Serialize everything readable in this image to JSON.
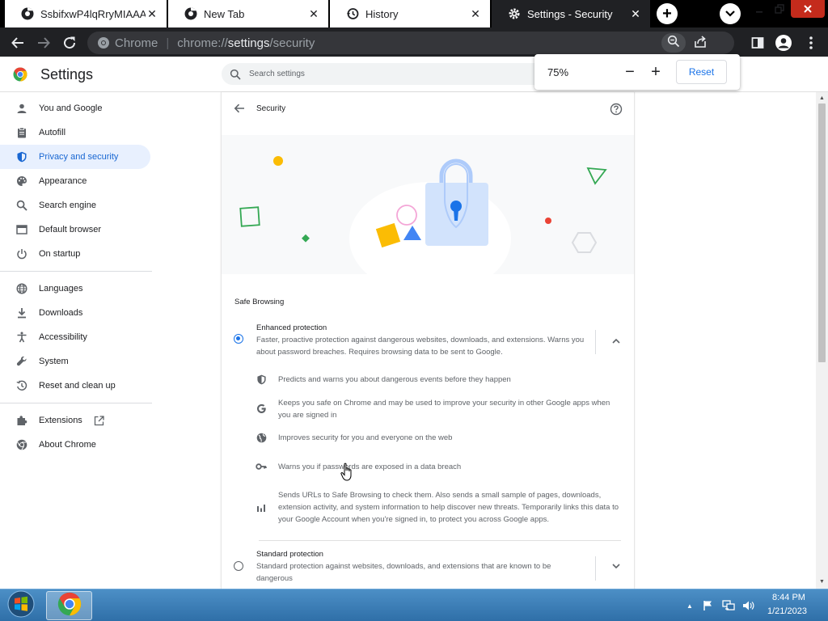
{
  "tabs": [
    {
      "title": "SsbifxwP4lqRryMIAAAA",
      "favicon": "chrome-icon",
      "active": false
    },
    {
      "title": "New Tab",
      "favicon": "chrome-icon",
      "active": false
    },
    {
      "title": "History",
      "favicon": "history-icon",
      "active": false
    },
    {
      "title": "Settings - Security",
      "favicon": "gear-icon",
      "active": true
    }
  ],
  "toolbar": {
    "omnibox_label": "Chrome",
    "url_scheme": "chrome://",
    "url_host": "settings",
    "url_path": "/security"
  },
  "zoom_bubble": {
    "level": "75%",
    "minus_label": "−",
    "plus_label": "+",
    "reset_label": "Reset"
  },
  "header": {
    "title": "Settings",
    "search_placeholder": "Search settings"
  },
  "sidebar": {
    "items": [
      {
        "label": "You and Google",
        "icon": "person-icon",
        "selected": false
      },
      {
        "label": "Autofill",
        "icon": "clipboard-icon",
        "selected": false
      },
      {
        "label": "Privacy and security",
        "icon": "shield-icon",
        "selected": true
      },
      {
        "label": "Appearance",
        "icon": "palette-icon",
        "selected": false
      },
      {
        "label": "Search engine",
        "icon": "search-icon",
        "selected": false
      },
      {
        "label": "Default browser",
        "icon": "browser-icon",
        "selected": false
      },
      {
        "label": "On startup",
        "icon": "power-icon",
        "selected": false
      },
      {
        "label": "Languages",
        "icon": "globe-icon",
        "selected": false
      },
      {
        "label": "Downloads",
        "icon": "download-icon",
        "selected": false
      },
      {
        "label": "Accessibility",
        "icon": "accessibility-icon",
        "selected": false
      },
      {
        "label": "System",
        "icon": "wrench-icon",
        "selected": false
      },
      {
        "label": "Reset and clean up",
        "icon": "history-icon",
        "selected": false
      },
      {
        "label": "Extensions",
        "icon": "puzzle-icon",
        "selected": false
      },
      {
        "label": "About Chrome",
        "icon": "chrome-icon",
        "selected": false
      }
    ]
  },
  "main": {
    "subtitle": "Security",
    "section_title": "Safe Browsing",
    "enhanced": {
      "title": "Enhanced protection",
      "description": "Faster, proactive protection against dangerous websites, downloads, and extensions. Warns you about password breaches. Requires browsing data to be sent to Google.",
      "checked": true
    },
    "features": [
      {
        "icon": "shield-icon",
        "text": "Predicts and warns you about dangerous events before they happen"
      },
      {
        "icon": "google-g-icon",
        "text": "Keeps you safe on Chrome and may be used to improve your security in other Google apps when you are signed in"
      },
      {
        "icon": "globe-icon",
        "text": "Improves security for you and everyone on the web"
      },
      {
        "icon": "key-icon",
        "text": "Warns you if passwords are exposed in a data breach"
      },
      {
        "icon": "bar-chart-icon",
        "text": "Sends URLs to Safe Browsing to check them. Also sends a small sample of pages, downloads, extension activity, and system information to help discover new threats. Temporarily links this data to your Google Account when you're signed in, to protect you across Google apps."
      }
    ],
    "standard": {
      "title": "Standard protection",
      "description": "Standard protection against websites, downloads, and extensions that are known to be dangerous",
      "checked": false
    }
  },
  "taskbar": {
    "time": "8:44 PM",
    "date": "1/21/2023"
  },
  "colors": {
    "accent": "#1a73e8",
    "selected_bg": "#e8f0fe",
    "selected_text": "#1967d2",
    "dark_chrome": "#202124",
    "taskbar": "#3b7cb8"
  }
}
